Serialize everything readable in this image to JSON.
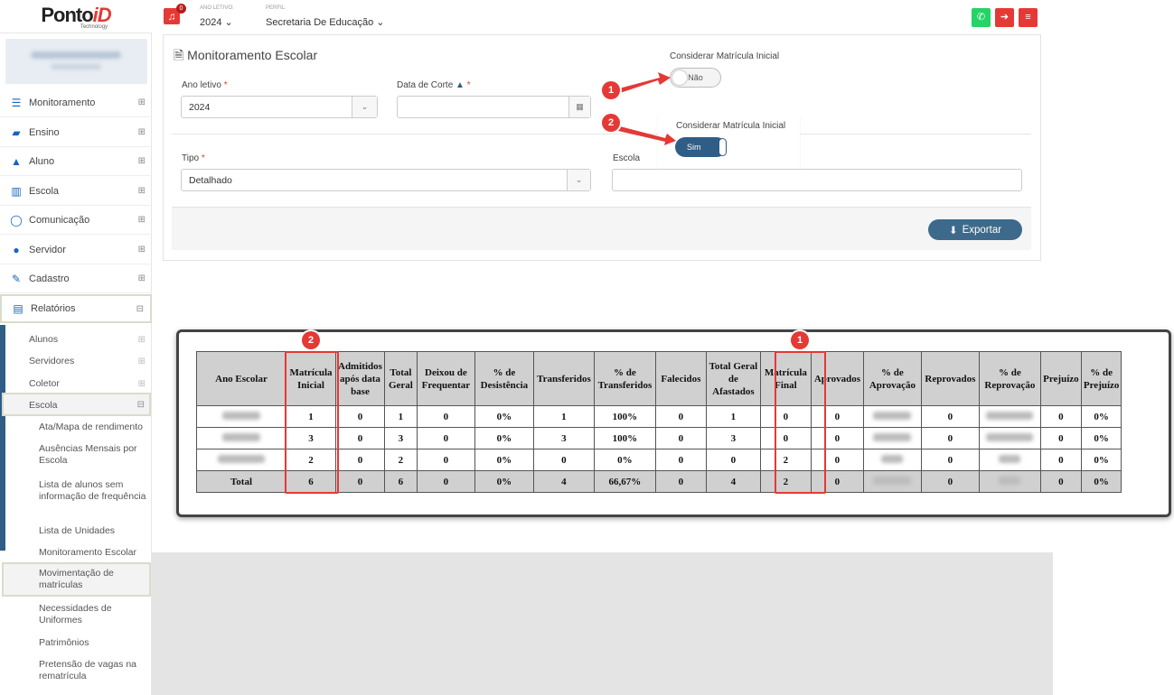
{
  "brand": {
    "name_a": "Ponto",
    "name_b": "iD",
    "tagline": "Technology"
  },
  "topbar": {
    "notif_count": "0",
    "ano_label": "ANO LETIVO:",
    "ano_value": "2024 ⌄",
    "perfil_label": "PERFIL:",
    "perfil_value": "Secretaria De Educação ⌄"
  },
  "sidebar": {
    "menu": [
      {
        "label": "Monitoramento",
        "icon": "sliders-icon"
      },
      {
        "label": "Ensino",
        "icon": "book-icon"
      },
      {
        "label": "Aluno",
        "icon": "graduation-cap-icon"
      },
      {
        "label": "Escola",
        "icon": "building-icon"
      },
      {
        "label": "Comunicação",
        "icon": "chat-icon"
      },
      {
        "label": "Servidor",
        "icon": "user-icon"
      },
      {
        "label": "Cadastro",
        "icon": "edit-icon"
      },
      {
        "label": "Relatórios",
        "icon": "document-icon"
      }
    ],
    "submenu": [
      "Alunos",
      "Servidores",
      "Coletor",
      "Escola"
    ],
    "escola_items": [
      "Ata/Mapa de rendimento",
      "Ausências Mensais por Escola",
      "Lista de alunos sem informação de frequência",
      "Lista de Unidades",
      "Monitoramento Escolar",
      "Movimentação de matrículas",
      "Necessidades de Uniformes",
      "Patrimônios",
      "Pretensão de vagas na rematrícula"
    ]
  },
  "form": {
    "title": "Monitoramento Escolar",
    "ano_letivo_label": "Ano letivo",
    "ano_letivo_value": "2024",
    "data_corte_label": "Data de Corte",
    "data_corte_value": "",
    "tipo_label": "Tipo",
    "tipo_value": "Detalhado",
    "escola_label": "Escola",
    "escola_value": "",
    "considerar_label": "Considerar Matrícula Inicial",
    "toggle_off_text": "Não",
    "popup_label": "Considerar Matrícula Inicial",
    "toggle_on_text": "Sim",
    "required_mark": "*",
    "export_label": "Exportar"
  },
  "badges": {
    "one": "1",
    "two": "2"
  },
  "report": {
    "headers": [
      "Ano Escolar",
      "Matrícula Inicial",
      "Admitidos após data base",
      "Total Geral",
      "Deixou de Frequentar",
      "% de Desistência",
      "Transferidos",
      "% de Transferidos",
      "Falecidos",
      "Total Geral de Afastados",
      "Matrícula Final",
      "Aprovados",
      "% de Aprovação",
      "Reprovados",
      "% de Reprovação",
      "Prejuízo",
      "% de Prejuízo"
    ],
    "rows": [
      [
        "",
        "1",
        "0",
        "1",
        "0",
        "0%",
        "1",
        "100%",
        "0",
        "1",
        "0",
        "0",
        "",
        "0",
        "",
        "0",
        "0%"
      ],
      [
        "",
        "3",
        "0",
        "3",
        "0",
        "0%",
        "3",
        "100%",
        "0",
        "3",
        "0",
        "0",
        "",
        "0",
        "",
        "0",
        "0%"
      ],
      [
        "",
        "2",
        "0",
        "2",
        "0",
        "0%",
        "0",
        "0%",
        "0",
        "0",
        "2",
        "0",
        "",
        "0",
        "",
        "0",
        "0%"
      ]
    ],
    "total": [
      "Total",
      "6",
      "0",
      "6",
      "0",
      "0%",
      "4",
      "66,67%",
      "0",
      "4",
      "2",
      "0",
      "",
      "0",
      "",
      "0",
      "0%"
    ]
  },
  "colors": {
    "accent": "#2f5d86",
    "alert": "#e53935",
    "whatsapp": "#25d366"
  }
}
